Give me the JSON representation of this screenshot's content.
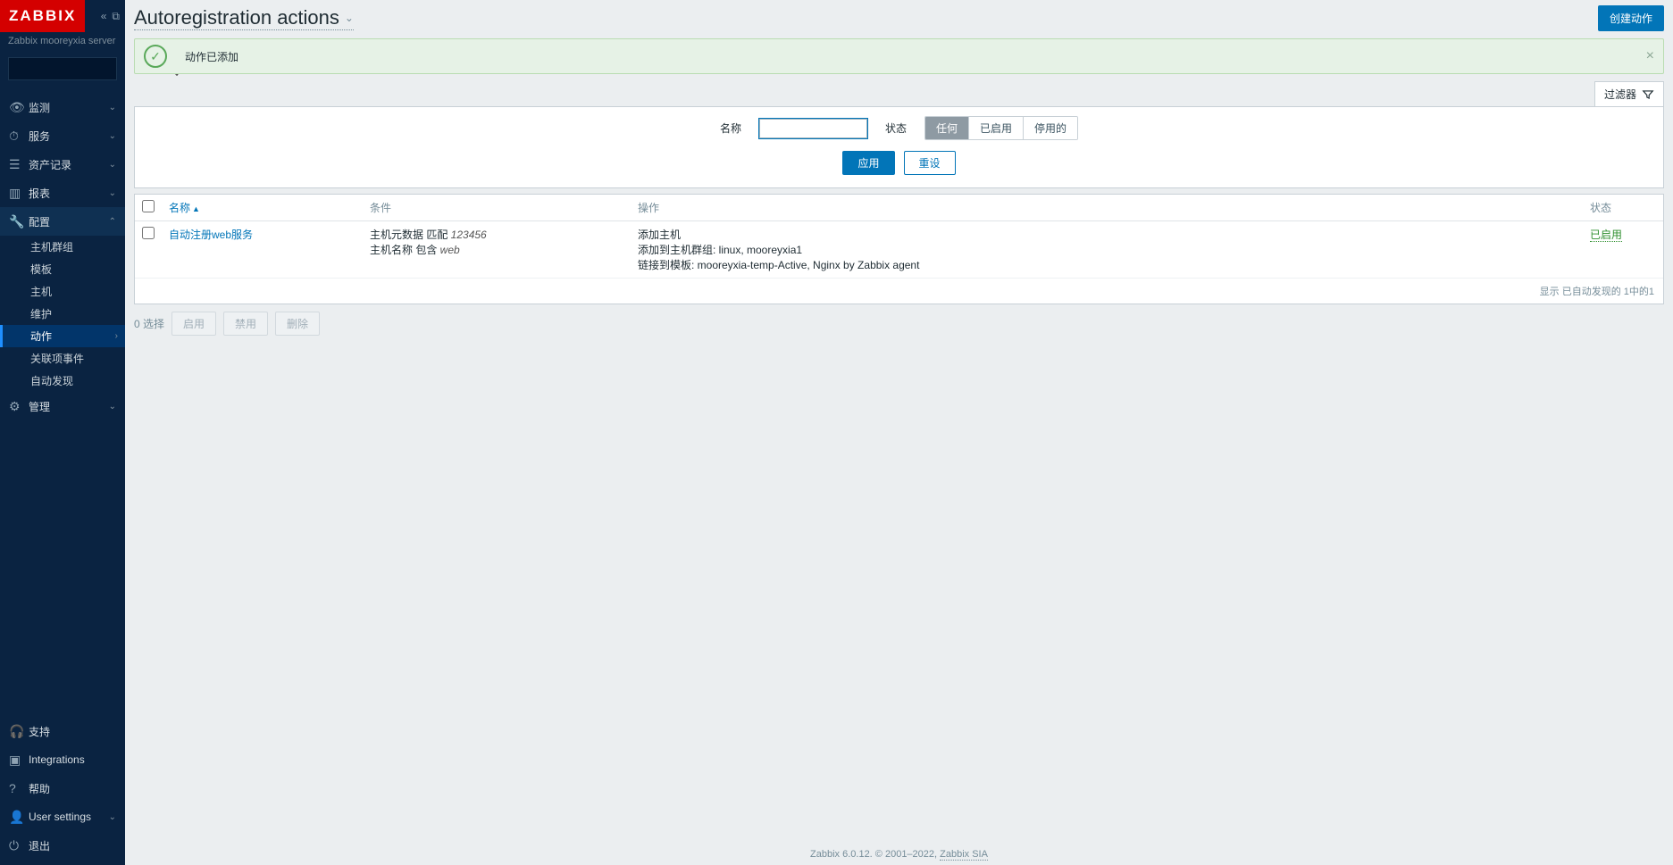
{
  "brand": "ZABBIX",
  "server_label": "Zabbix mooreyxia server",
  "nav": {
    "monitor": "监测",
    "services": "服务",
    "inventory": "资产记录",
    "reports": "报表",
    "config": "配置",
    "admin": "管理"
  },
  "config_sub": {
    "hostgroups": "主机群组",
    "templates": "模板",
    "hosts": "主机",
    "maintenance": "维护",
    "actions": "动作",
    "correlation": "关联项事件",
    "discovery": "自动发现"
  },
  "bottom_nav": {
    "support": "支持",
    "integrations": "Integrations",
    "help": "帮助",
    "user_settings": "User settings",
    "logout": "退出"
  },
  "page": {
    "title": "Autoregistration actions",
    "create_button": "创建动作"
  },
  "alert": {
    "message": "动作已添加"
  },
  "filter": {
    "tab_label": "过滤器",
    "name_label": "名称",
    "name_value": "",
    "status_label": "状态",
    "seg_any": "任何",
    "seg_enabled": "已启用",
    "seg_disabled": "停用的",
    "apply": "应用",
    "reset": "重设"
  },
  "table": {
    "col_name": "名称",
    "col_conditions": "条件",
    "col_operations": "操作",
    "col_status": "状态",
    "rows": [
      {
        "name": "自动注册web服务",
        "cond_l1_a": "主机元数据 匹配 ",
        "cond_l1_b": "123456",
        "cond_l2_a": "主机名称 包含 ",
        "cond_l2_b": "web",
        "op_l1": "添加主机",
        "op_l2": "添加到主机群组: linux, mooreyxia1",
        "op_l3": "链接到模板: mooreyxia-temp-Active, Nginx by Zabbix agent",
        "status": "已启用"
      }
    ],
    "footer": "显示 已自动发现的 1中的1"
  },
  "bulk": {
    "selected": "0 选择",
    "enable": "启用",
    "disable": "禁用",
    "delete": "删除"
  },
  "footer": {
    "text": "Zabbix 6.0.12. © 2001–2022, ",
    "link": "Zabbix SIA"
  }
}
